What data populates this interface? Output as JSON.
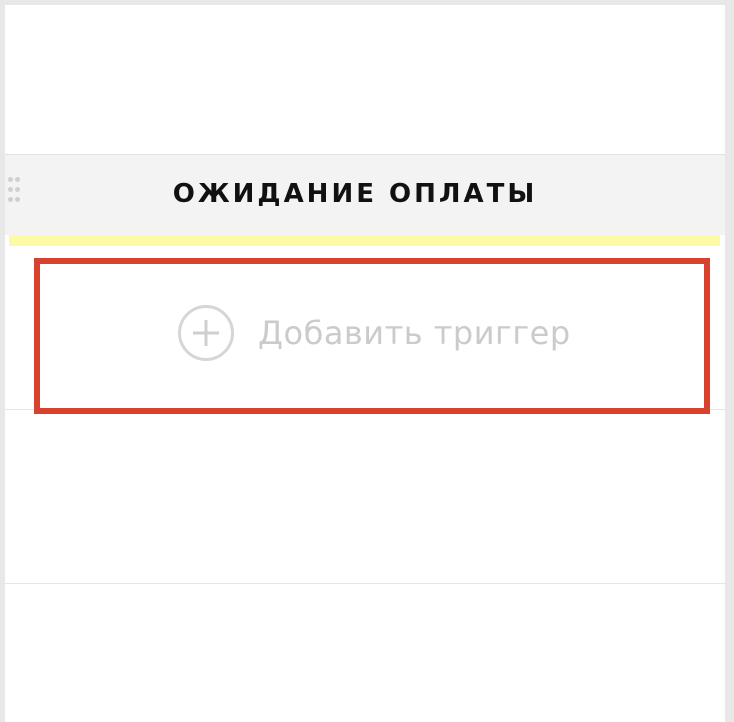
{
  "column": {
    "title": "ОЖИДАНИЕ ОПЛАТЫ",
    "status_color": "#fdfaa6"
  },
  "trigger": {
    "add_label": "Добавить триггер",
    "icon": "plus-circle-icon"
  },
  "highlight": {
    "color": "#d9412f"
  }
}
